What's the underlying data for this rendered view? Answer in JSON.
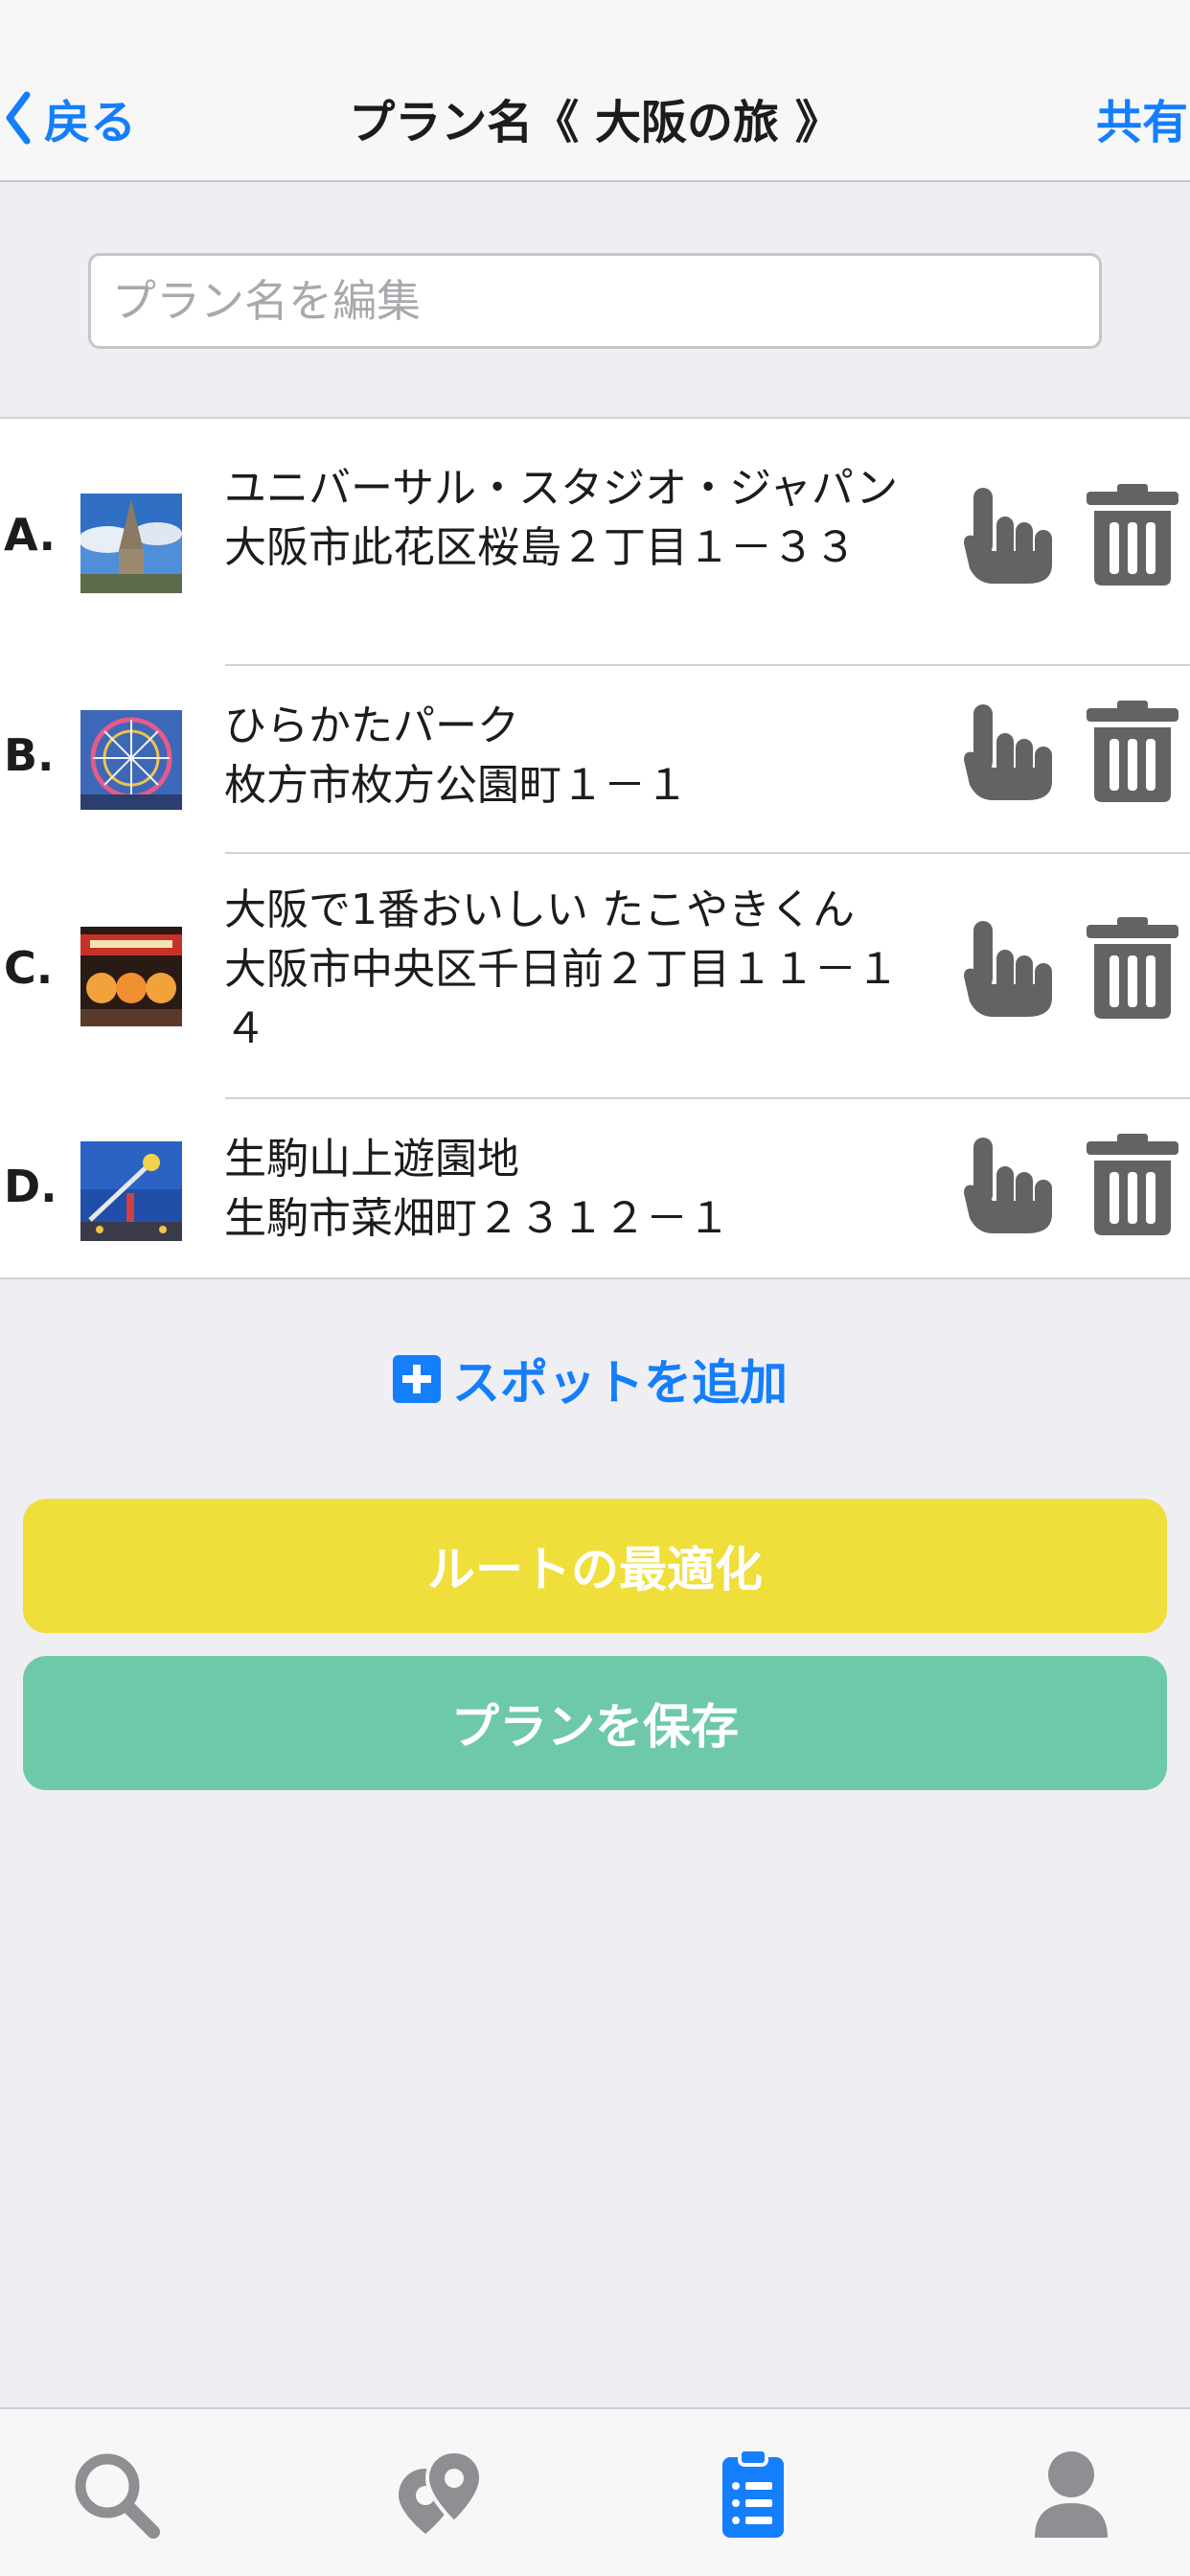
{
  "nav": {
    "back_label": "戻る",
    "title": "プラン名《 大阪の旅 》",
    "share_label": "共有"
  },
  "plan_name": {
    "value": "",
    "placeholder": "プラン名を編集"
  },
  "spots": [
    {
      "letter": "A.",
      "name": "ユニバーサル・スタジオ・ジャパン",
      "address": "大阪市此花区桜島２丁目１－３３",
      "thumb_icon": "castle-photo"
    },
    {
      "letter": "B.",
      "name": "ひらかたパーク",
      "address": "枚方市枚方公園町１－１",
      "thumb_icon": "ferris-wheel-photo"
    },
    {
      "letter": "C.",
      "name": "大阪で1番おいしい たこやきくん",
      "address": "大阪市中央区千日前２丁目１１－１４",
      "thumb_icon": "lantern-shop-photo"
    },
    {
      "letter": "D.",
      "name": "生駒山上遊園地",
      "address": "生駒市菜畑町２３１２－１",
      "thumb_icon": "amusement-ride-photo"
    }
  ],
  "add_spot_label": "スポットを追加",
  "buttons": {
    "optimize_label": "ルートの最適化",
    "save_label": "プランを保存"
  },
  "tabs": [
    {
      "icon": "search-icon",
      "active": false
    },
    {
      "icon": "map-pins-icon",
      "active": false
    },
    {
      "icon": "clipboard-list-icon",
      "active": true
    },
    {
      "icon": "user-icon",
      "active": false
    }
  ],
  "colors": {
    "accent": "#147efb",
    "optimize_button": "#f0de3a",
    "save_button": "#6ec9a8",
    "action_icon": "#636366",
    "tab_inactive": "#8e8e93"
  }
}
